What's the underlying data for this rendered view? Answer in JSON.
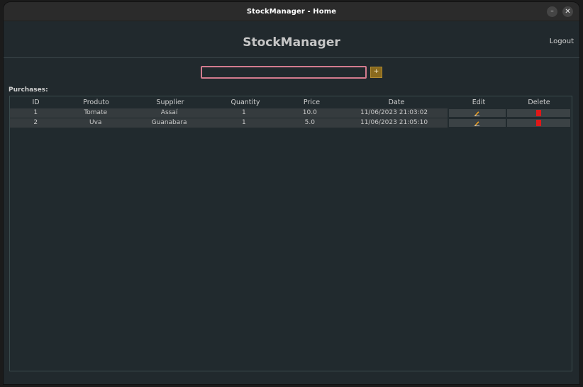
{
  "window": {
    "title": "StockManager - Home",
    "minimize": "–",
    "close": "✕"
  },
  "header": {
    "app_title": "StockManager",
    "logout": "Logout"
  },
  "search": {
    "value": "",
    "add_label": "+"
  },
  "purchases": {
    "label": "Purchases:",
    "columns": [
      "ID",
      "Produto",
      "Supplier",
      "Quantity",
      "Price",
      "Date",
      "Edit",
      "Delete"
    ],
    "rows": [
      {
        "id": "1",
        "produto": "Tomate",
        "supplier": "Assaí",
        "quantity": "1",
        "price": "10.0",
        "date": "11/06/2023 21:03:02"
      },
      {
        "id": "2",
        "produto": "Uva",
        "supplier": "Guanabara",
        "quantity": "1",
        "price": "5.0",
        "date": "11/06/2023 21:05:10"
      }
    ]
  },
  "colors": {
    "accent_input_border": "#d37b8e",
    "add_button": "#8a6a1e",
    "delete_icon": "#e01818",
    "edit_icon": "#f0a020"
  },
  "icons": {
    "edit": "pencil-icon",
    "delete": "trash-icon"
  }
}
